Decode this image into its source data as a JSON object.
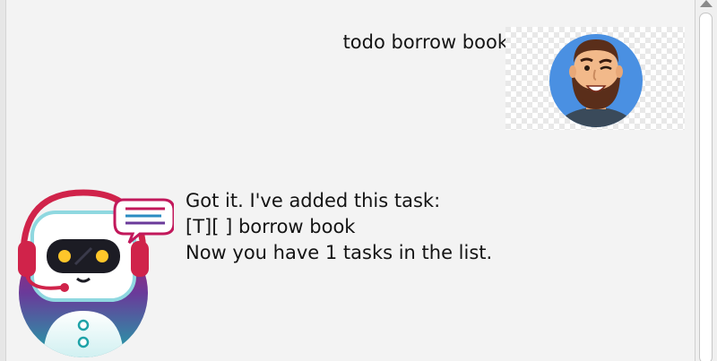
{
  "dialogs": [
    {
      "speaker": "user",
      "avatar": "user-avatar-icon",
      "text": "todo borrow book"
    },
    {
      "speaker": "bot",
      "avatar": "robot-avatar-icon",
      "lines": [
        "Got it. I've added this task:",
        "[T][ ] borrow book",
        "Now you have 1 tasks in the list."
      ]
    }
  ],
  "colors": {
    "background": "#f3f3f3",
    "user_avatar_bg": "#4a90e2",
    "robot_headset": "#d0234a",
    "robot_gradient_top": "#c2185b",
    "robot_gradient_bottom": "#1fa3a8"
  }
}
